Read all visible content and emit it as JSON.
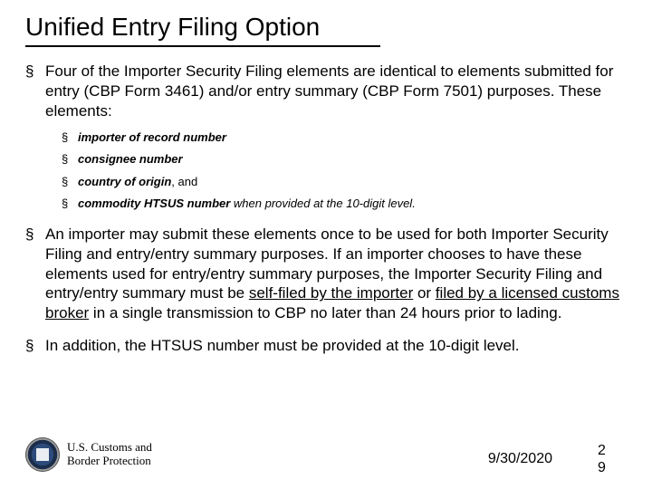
{
  "title": "Unified Entry Filing Option",
  "bullets": {
    "b1_text": "Four of the Importer Security Filing elements are identical to elements submitted for entry (CBP Form 3461) and/or entry summary (CBP Form 7501) purposes. These elements:",
    "b2_pre": "An importer may submit these elements once to be used for both Importer Security Filing and entry/entry summary purposes. If an importer chooses to have these elements used for entry/entry summary purposes, the Importer Security Filing and entry/entry summary must be ",
    "b2_u1": "self-filed by the importer",
    "b2_mid": " or ",
    "b2_u2": "filed by a licensed customs broker",
    "b2_post": " in a single transmission to CBP no later than 24 hours prior to lading.",
    "b3_text": "In addition, the HTSUS number must be provided at the 10-digit level."
  },
  "sub": {
    "s1": "importer of record number",
    "s2": "consignee number",
    "s3_bold": "country of origin",
    "s3_rest": ", and",
    "s4_bold": "commodity HTSUS number",
    "s4_rest": " when provided at the 10-digit level."
  },
  "footer": {
    "agency_line1": "U.S. Customs and",
    "agency_line2": "Border Protection",
    "date": "9/30/2020",
    "page_a": "2",
    "page_b": "9"
  }
}
